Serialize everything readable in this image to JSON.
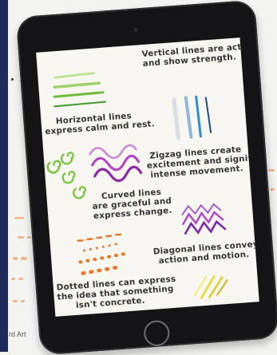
{
  "corner_caption": "rd Art",
  "panels": {
    "vertical": {
      "line1": "Vertical lines are active",
      "line2": "and show strength."
    },
    "horizontal": {
      "line1": "Horizontal lines",
      "line2": "express calm and rest."
    },
    "zigzag": {
      "line1": "Zigzag lines create",
      "line2": "excitement and signify",
      "line3": "intense movement."
    },
    "curved": {
      "line1": "Curved lines",
      "line2": "are graceful and",
      "line3": "express change."
    },
    "diagonal": {
      "line1": "Diagonal lines convey",
      "line2": "action and motion."
    },
    "dotted": {
      "line1": "Dotted lines can express",
      "line2": "the idea that something",
      "line3": "isn't concrete."
    }
  },
  "colors": {
    "green": "#7cc242",
    "blue": "#2b8fc8",
    "purple": "#b043c8",
    "orange": "#e4782a",
    "yellow": "#e6df4a"
  }
}
